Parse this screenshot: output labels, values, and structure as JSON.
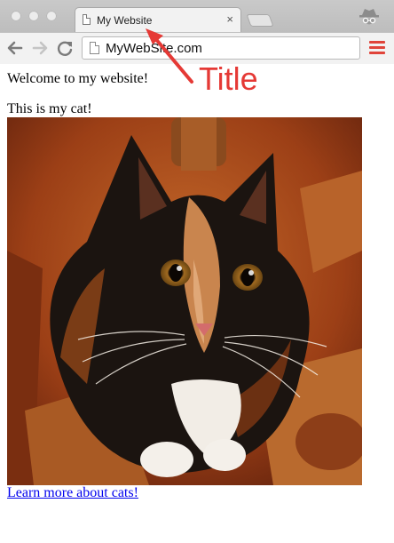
{
  "browser": {
    "tab": {
      "title": "My Website",
      "close_label": "×"
    },
    "address_bar": {
      "url": "MyWebSite.com"
    },
    "icons": {
      "back": "back-arrow-icon",
      "forward": "forward-arrow-icon",
      "reload": "reload-icon",
      "menu": "hamburger-menu-icon",
      "incognito": "incognito-icon",
      "page": "page-icon"
    },
    "colors": {
      "menu_accent": "#e0443a"
    }
  },
  "page": {
    "welcome_text": "Welcome to my website!",
    "cat_caption": "This is my cat!",
    "link_text": "Learn more about cats!"
  },
  "annotation": {
    "label": "Title",
    "color": "#e53935"
  }
}
